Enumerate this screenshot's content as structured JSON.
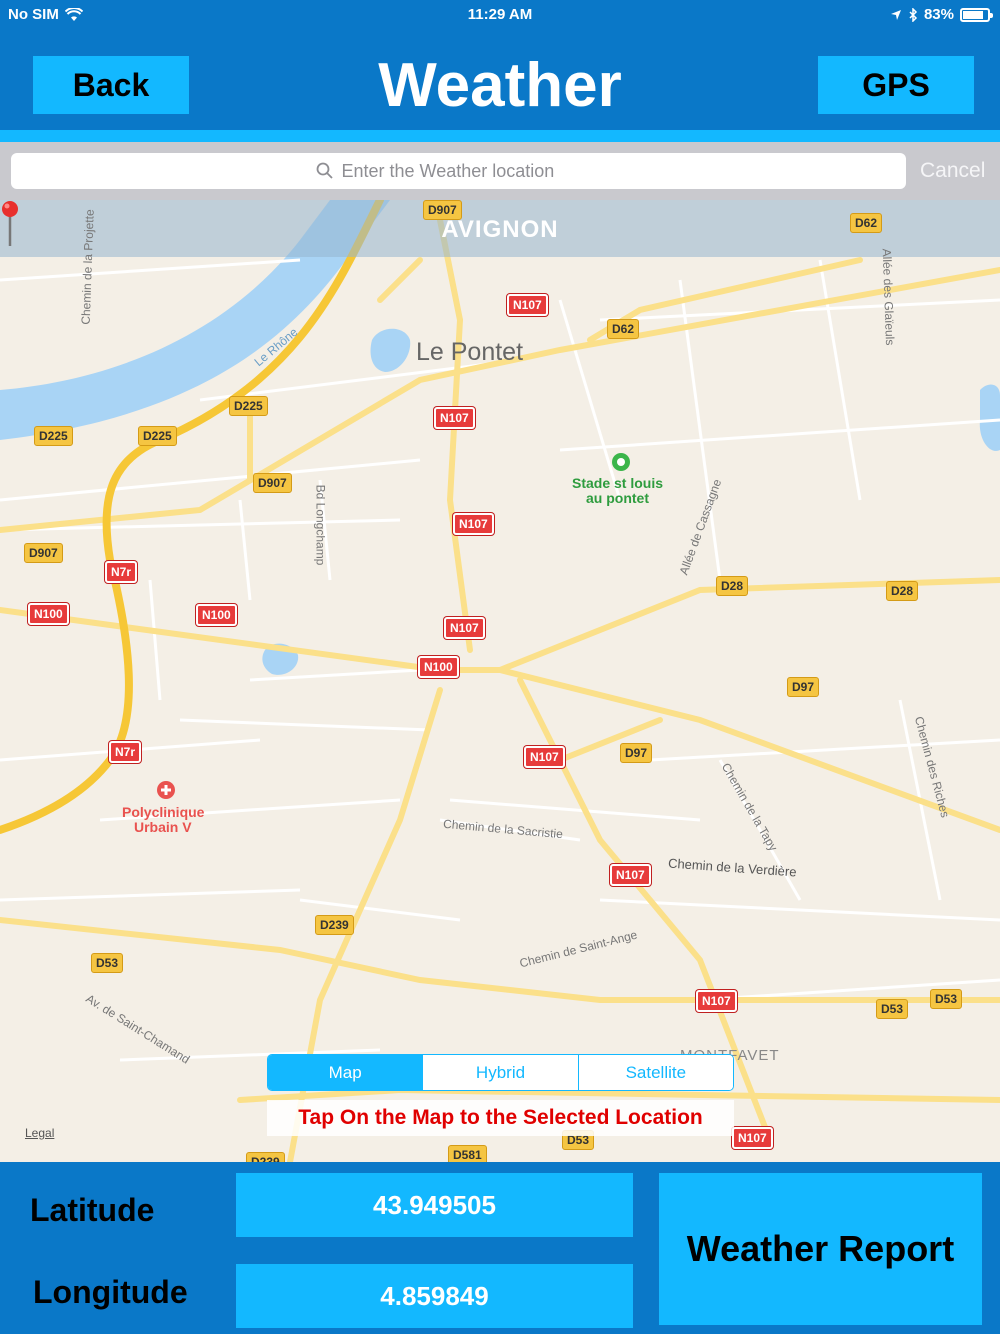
{
  "status_bar": {
    "carrier": "No SIM",
    "time": "11:29 AM",
    "battery": "83%",
    "battery_level": 0.83
  },
  "header": {
    "title": "Weather",
    "back_label": "Back",
    "gps_label": "GPS"
  },
  "search": {
    "placeholder": "Enter the Weather location",
    "cancel_label": "Cancel"
  },
  "map": {
    "location_name": "AVIGNON",
    "places": {
      "le_pontet": "Le Pontet",
      "stade_line1": "Stade st louis",
      "stade_line2": "au pontet",
      "clinic_line1": "Polyclinique",
      "clinic_line2": "Urbain V",
      "montfavet": "MONTFAVET"
    },
    "streets": {
      "chemin_projette": "Chemin de la Projette",
      "le_rhone": "Le Rhône",
      "bd_longchamp": "Bd Longchamp",
      "allee_cassagne": "Allée de Cassagne",
      "allee_glaieuls": "Allée des Glaïeuls",
      "chemin_sacristie": "Chemin de la Sacristie",
      "chemin_tapy": "Chemin de la Tapy",
      "chemin_verdiere": "Chemin de la Verdière",
      "chemin_riches": "Chemin des Riches",
      "chemin_saint_ange": "Chemin de Saint-Ange",
      "av_saint_chamand": "Av. de Saint-Chamand"
    },
    "road_labels": {
      "d907_top": "D907",
      "d62_top": "D62",
      "n107_a": "N107",
      "d62_b": "D62",
      "d225_a": "D225",
      "d225_b": "D225",
      "d225_c": "D225",
      "n107_b": "N107",
      "d907_b": "D907",
      "n107_c": "N107",
      "d907_c": "D907",
      "n7r_a": "N7r",
      "n100_a": "N100",
      "n100_b": "N100",
      "n107_d": "N107",
      "n100_c": "N100",
      "d28_a": "D28",
      "d28_b": "D28",
      "d97_a": "D97",
      "n107_e": "N107",
      "d97_b": "D97",
      "n7r_b": "N7r",
      "n107_f": "N107",
      "d239_a": "D239",
      "d53_a": "D53",
      "n107_g": "N107",
      "d53_b": "D53",
      "d53_c": "D53",
      "n107_h": "N107",
      "d53_d": "D53",
      "d581": "D581",
      "d239_b": "D239"
    },
    "map_types": [
      "Map",
      "Hybrid",
      "Satellite"
    ],
    "selected_map_type": "Map",
    "hint": "Tap On the Map to the Selected Location",
    "legal": "Legal"
  },
  "coordinates": {
    "latitude_label": "Latitude",
    "longitude_label": "Longitude",
    "latitude": "43.949505",
    "longitude": "4.859849"
  },
  "report_button": "Weather Report"
}
